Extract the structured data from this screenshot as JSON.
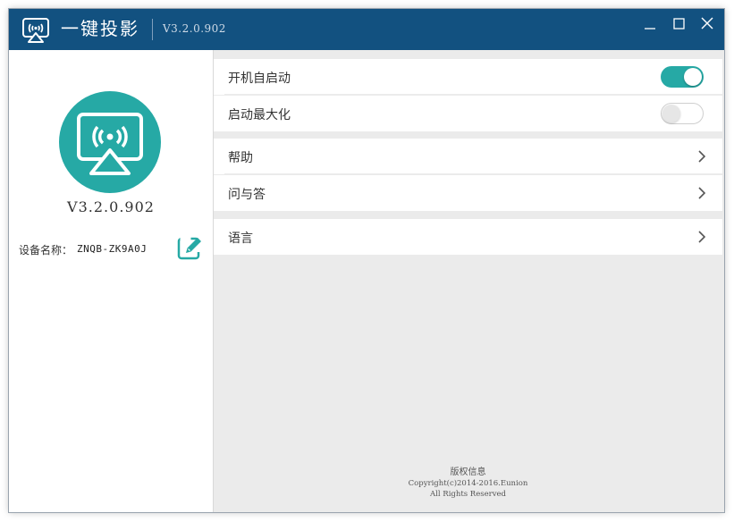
{
  "titlebar": {
    "app_icon": "wifi-cast-icon",
    "title": "一键投影",
    "version": "V3.2.0.902",
    "minimize_icon": "minimize-icon",
    "maximize_icon": "maximize-icon",
    "close_icon": "close-icon"
  },
  "left": {
    "logo_icon": "wifi-cast-icon",
    "version": "V3.2.0.902",
    "device_label": "设备名称：",
    "device_name": "ZNQB-ZK9A0J",
    "edit_icon": "edit-icon"
  },
  "settings": {
    "items": [
      {
        "label": "开机自启动",
        "type": "toggle",
        "on": true
      },
      {
        "label": "启动最大化",
        "type": "toggle",
        "on": false
      },
      {
        "label": "帮助",
        "type": "link"
      },
      {
        "label": "问与答",
        "type": "link"
      },
      {
        "label": "语言",
        "type": "link"
      }
    ]
  },
  "footer": {
    "title": "版权信息",
    "copyright": "Copyright(c)2014-2016.Eunion",
    "rights": "All Rights Reserved"
  },
  "colors": {
    "titlebar": "#125180",
    "accent": "#26a9a5",
    "panel_bg": "#ebebeb"
  }
}
